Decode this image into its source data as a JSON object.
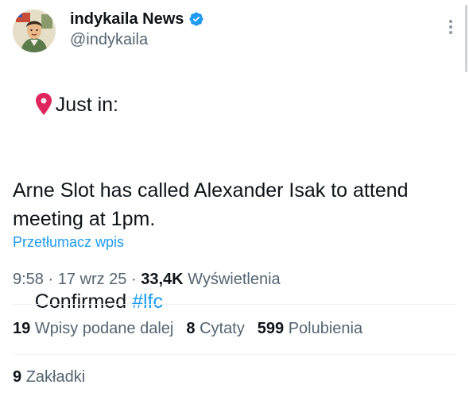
{
  "author": {
    "display_name": "indykaila News",
    "handle": "@indykaila",
    "verified": true,
    "icons": {
      "verified": "verified-badge-icon",
      "more": "more-vertical-icon"
    }
  },
  "tweet": {
    "lines": [
      {
        "icon": "pin-icon",
        "text": "Just in:"
      },
      {
        "text": "Arne Slot has called Alexander Isak to attend"
      },
      {
        "text": "meeting at 1pm."
      },
      {
        "text": "Confirmed ",
        "hashtag": "#lfc"
      }
    ]
  },
  "translate_label": "Przetłumacz wpis",
  "meta": {
    "time": "9:58",
    "date": "17 wrz 25",
    "views_count": "33,4K",
    "views_label": "Wyświetlenia",
    "sep": " · "
  },
  "stats": {
    "reposts": {
      "count": "19",
      "label": "Wpisy podane dalej"
    },
    "quotes": {
      "count": "8",
      "label": "Cytaty"
    },
    "likes": {
      "count": "599",
      "label": "Polubienia"
    },
    "bookmarks": {
      "count": "9",
      "label": "Zakładki"
    }
  },
  "colors": {
    "accent": "#1d9bf0",
    "secondary_text": "#536471",
    "primary_text": "#0f1419",
    "divider": "#eff3f4"
  }
}
